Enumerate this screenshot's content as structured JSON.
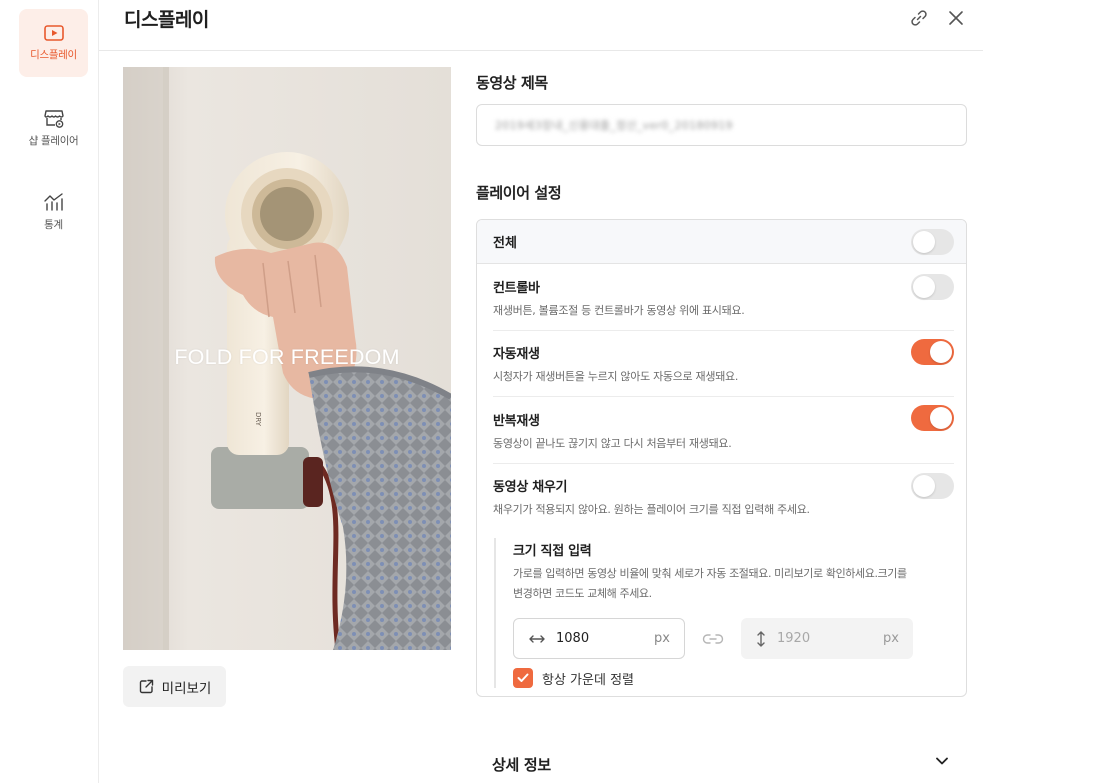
{
  "sidebar": {
    "items": [
      {
        "label": "디스플레이",
        "icon": "play-icon",
        "active": true
      },
      {
        "label": "샵 플레이어",
        "icon": "shop-player-icon",
        "active": false
      },
      {
        "label": "통계",
        "icon": "stats-icon",
        "active": false
      }
    ]
  },
  "header": {
    "title": "디스플레이",
    "link_icon": "link-icon",
    "close_icon": "close-icon"
  },
  "video": {
    "caption": "FOLD FOR FREEDOM"
  },
  "preview_button": {
    "label": "미리보기",
    "icon": "external-link-icon"
  },
  "video_title": {
    "label": "동영상 제목",
    "value": "2019세3장내_신용대출_정산_ver0_20180919"
  },
  "player_settings": {
    "label": "플레이어 설정",
    "all": {
      "label": "전체",
      "on": false
    },
    "options": [
      {
        "label": "컨트롤바",
        "desc": "재생버튼, 볼륨조절 등 컨트롤바가 동영상 위에 표시돼요.",
        "on": false
      },
      {
        "label": "자동재생",
        "desc": "시청자가 재생버튼을 누르지 않아도 자동으로 재생돼요.",
        "on": true
      },
      {
        "label": "반복재생",
        "desc": "동영상이 끝나도 끊기지 않고 다시 처음부터 재생돼요.",
        "on": true
      },
      {
        "label": "동영상 채우기",
        "desc": "채우기가 적용되지 않아요. 원하는 플레이어 크기를 직접 입력해 주세요.",
        "on": false
      }
    ],
    "custom_size": {
      "label": "크기 직접 입력",
      "desc": "가로를 입력하면 동영상 비율에 맞춰 세로가 자동 조절돼요. 미리보기로 확인하세요.크기를 변경하면 코드도 교체해 주세요.",
      "width": "1080",
      "height": "1920",
      "unit": "px",
      "center_label": "항상 가운데 정렬",
      "center_checked": true
    }
  },
  "detail": {
    "label": "상세 정보"
  },
  "colors": {
    "accent": "#ef6a3f",
    "active_bg": "#fdeee8"
  }
}
